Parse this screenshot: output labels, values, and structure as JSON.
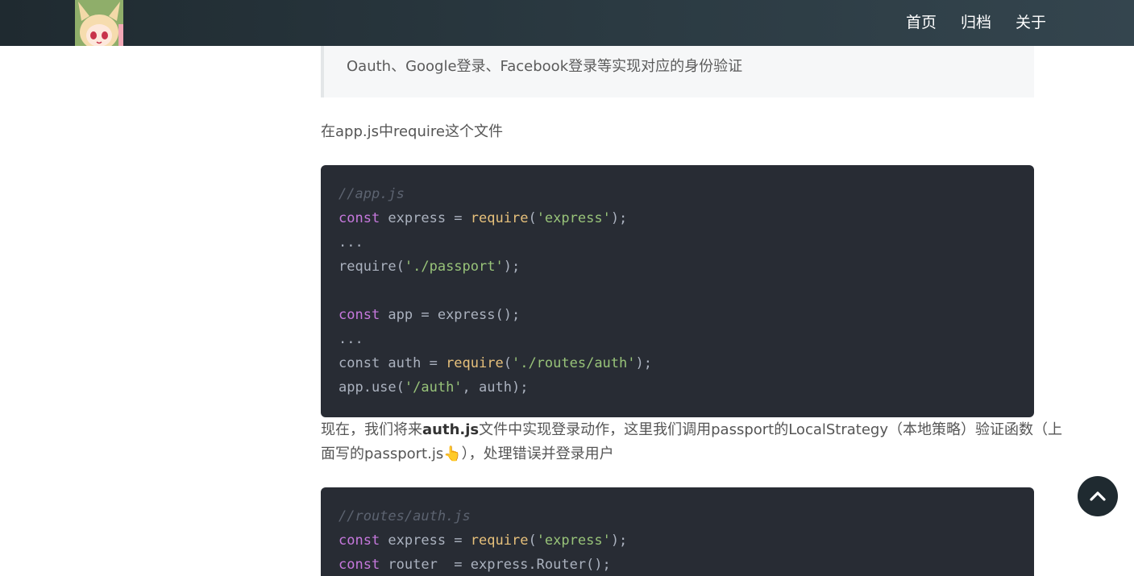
{
  "nav": {
    "links": [
      "首页",
      "归档",
      "关于"
    ]
  },
  "blockquote": {
    "text": "Oauth、Google登录、Facebook登录等实现对应的身份验证"
  },
  "para1": "在app.js中require这个文件",
  "code1": {
    "lines": [
      "//app.js",
      "const express = require('express');",
      "...",
      "require('./passport');",
      "",
      "const app = express();",
      "...",
      "const auth = require('./routes/auth');",
      "app.use('/auth', auth);"
    ]
  },
  "para2": {
    "line1_before": "现在，我们将来",
    "line1_bold": "auth.js",
    "line1_after": "文件中实现登录动作，这里我们调用passport的LocalStrategy（本地策略）验证函数（上",
    "line2_before": "面写的passport.js",
    "line2_emoji": "👆",
    "line2_after": "），处理错误并登录用户"
  },
  "code2": {
    "lines": [
      "//routes/auth.js",
      "const express = require('express');",
      "const router  = express.Router();"
    ]
  },
  "colors": {
    "header": "#2b3a42",
    "code_bg": "#282c34",
    "keyword": "#c678dd",
    "function": "#e6c07b",
    "string": "#98c379",
    "comment": "#5c6370"
  },
  "icons": {
    "back_to_top": "chevron-up-icon",
    "logo": "anime-avatar-logo"
  }
}
